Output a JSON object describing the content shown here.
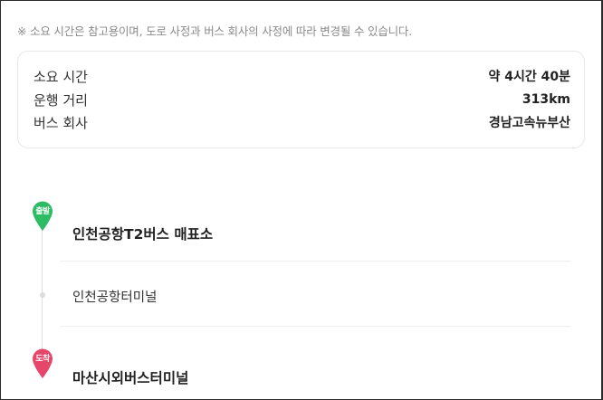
{
  "notice": "※ 소요 시간은 참고용이며, 도로 사정과 버스 회사의 사정에 따라 변경될 수 있습니다.",
  "summary": {
    "rows": [
      {
        "label": "소요 시간",
        "value": "약 4시간 40분"
      },
      {
        "label": "운행 거리",
        "value": "313km"
      },
      {
        "label": "버스 회사",
        "value": "경남고속뉴부산"
      }
    ]
  },
  "route": {
    "start": {
      "badge": "출발",
      "name": "인천공항T2버스 매표소",
      "color": "#2dbb64"
    },
    "via": {
      "name": "인천공항터미널"
    },
    "end": {
      "badge": "도착",
      "name": "마산시외버스터미널",
      "color": "#e8456a"
    }
  }
}
